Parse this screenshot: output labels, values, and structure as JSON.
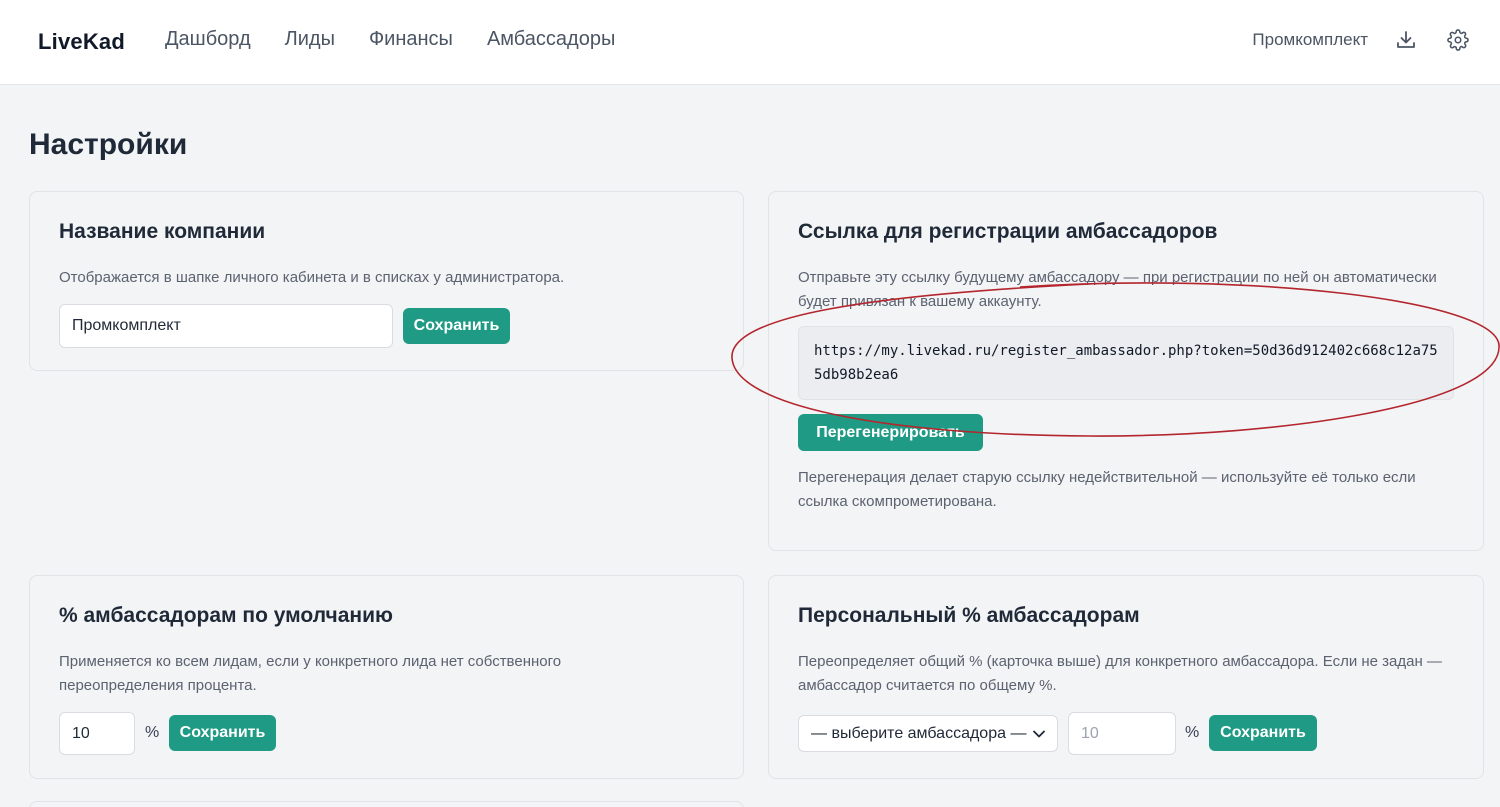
{
  "header": {
    "brand": "LiveKad",
    "nav": [
      "Дашборд",
      "Лиды",
      "Финансы",
      "Амбассадоры"
    ],
    "company_name": "Промкомплект",
    "download_icon": "download-icon",
    "settings_icon": "gear-icon"
  },
  "page": {
    "title": "Настройки"
  },
  "company_card": {
    "title": "Название компании",
    "description": "Отображается в шапке личного кабинета и в списках у администратора.",
    "input_value": "Промкомплект",
    "save_label": "Сохранить"
  },
  "link_card": {
    "title": "Ссылка для регистрации амбассадоров",
    "description": "Отправьте эту ссылку будущему амбассадору — при регистрации по ней он автоматически будет привязан к вашему аккаунту.",
    "url": "https://my.livekad.ru/register_ambassador.php?token=50d36d912402c668c12a755db98b2ea6",
    "regenerate_label": "Перегенерировать",
    "note": "Перегенерация делает старую ссылку недействительной — используйте её только если ссылка скомпрометирована."
  },
  "default_pct_card": {
    "title": "% амбассадорам по умолчанию",
    "description": "Применяется ко всем лидам, если у конкретного лида нет собственного переопределения процента.",
    "value": "10",
    "unit": "%",
    "save_label": "Сохранить"
  },
  "personal_pct_card": {
    "title": "Персональный % амбассадорам",
    "description": "Переопределяет общий % (карточка выше) для конкретного амбассадора. Если не задан — амбассадор считается по общему %.",
    "select_value": "— выберите амбассадора —",
    "value_placeholder": "10",
    "unit": "%",
    "save_label": "Сохранить"
  },
  "colors": {
    "accent": "#1f9a84",
    "annotation": "#b3262d"
  }
}
